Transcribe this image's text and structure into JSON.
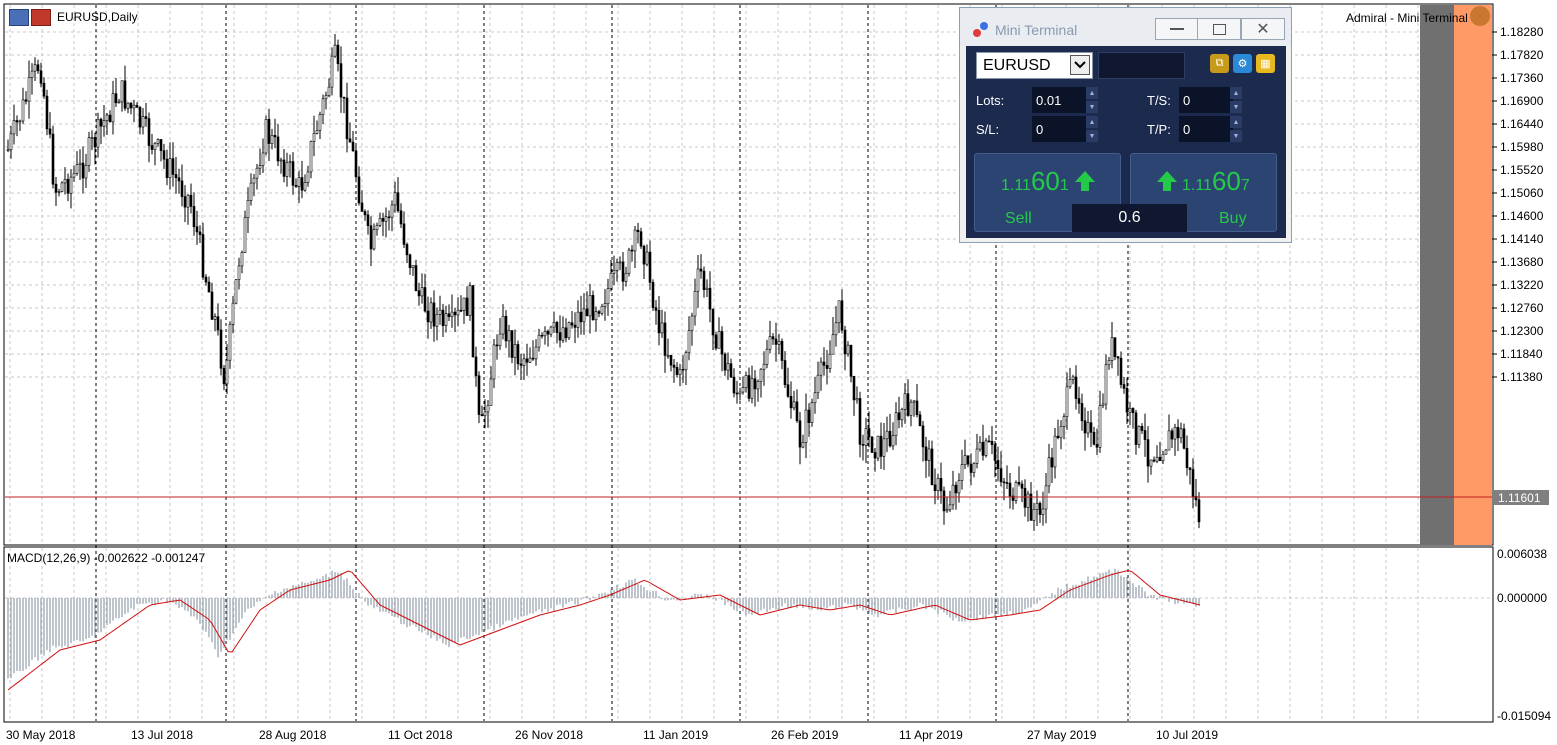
{
  "chart": {
    "symbol_label": "EURUSD,Daily",
    "broker_label": "Admiral - Mini Terminal",
    "current_price_label": "1.11601",
    "price_axis": [
      "1.18280",
      "1.17820",
      "1.17360",
      "1.16900",
      "1.16440",
      "1.15980",
      "1.15520",
      "1.15060",
      "1.14600",
      "1.14140",
      "1.13680",
      "1.13220",
      "1.12760",
      "1.12300",
      "1.11840",
      "1.11380"
    ],
    "date_axis": [
      "30 May 2018",
      "13 Jul 2018",
      "28 Aug 2018",
      "11 Oct 2018",
      "26 Nov 2018",
      "11 Jan 2019",
      "26 Feb 2019",
      "11 Apr 2019",
      "27 May 2019",
      "10 Jul 2019"
    ],
    "colors": {
      "candle": "#000000",
      "price_line": "#c02020",
      "macd_hist": "#9aa4b0",
      "macd_signal": "#d01010",
      "grid": "#c0c0c0",
      "overlay_grey": "#707070",
      "overlay_orange": "#ff9966"
    }
  },
  "macd": {
    "label": "MACD(12,26,9) -0.002622 -0.001247",
    "axis": [
      "0.006038",
      "0.000000",
      "-0.015094"
    ]
  },
  "mini_terminal": {
    "title": "Mini Terminal",
    "symbol": "EURUSD",
    "lots_label": "Lots:",
    "lots_value": "0.01",
    "sl_label": "S/L:",
    "sl_value": "0",
    "ts_label": "T/S:",
    "ts_value": "0",
    "tp_label": "T/P:",
    "tp_value": "0",
    "sell": {
      "price_small": "1.11",
      "price_big": "60",
      "price_last": "1",
      "label": "Sell"
    },
    "buy": {
      "price_small": "1.11",
      "price_big": "60",
      "price_last": "7",
      "label": "Buy"
    },
    "spread": "0.6",
    "icons": [
      "copy-icon",
      "settings-icon",
      "layout-icon"
    ]
  }
}
